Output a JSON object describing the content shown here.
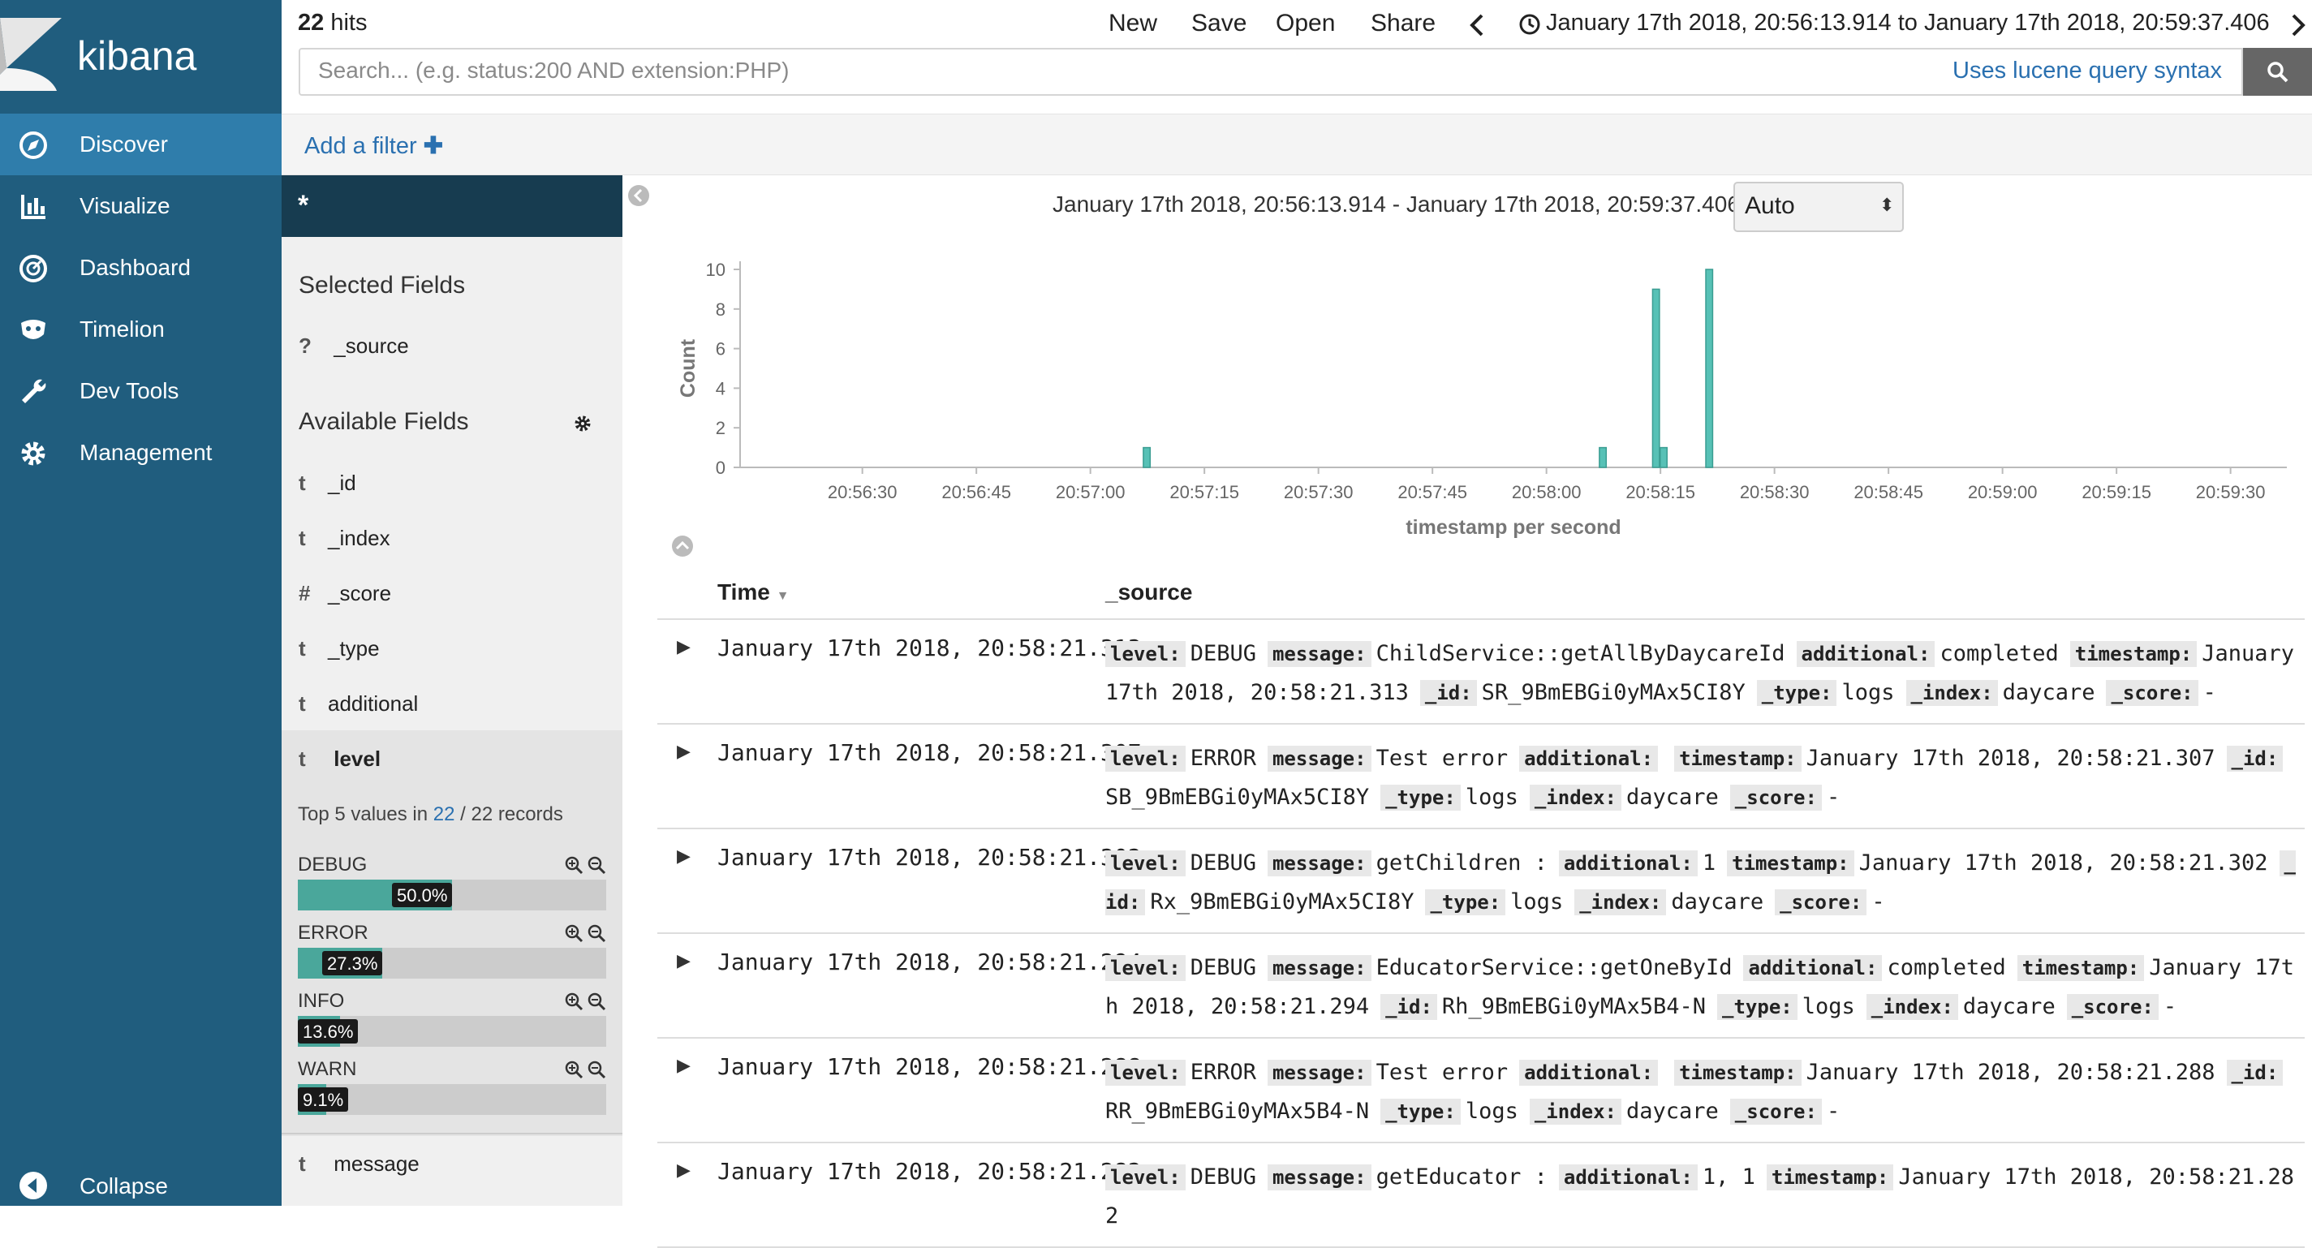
{
  "app": {
    "brand": "kibana",
    "colors": {
      "sidebar": "#205d7e",
      "active_nav": "#2f7dab",
      "accent": "#4aa79b",
      "link": "#2a70b0"
    }
  },
  "sidebar": {
    "items": [
      {
        "label": "Discover",
        "icon": "compass-icon",
        "active": true
      },
      {
        "label": "Visualize",
        "icon": "bar-chart-icon",
        "active": false
      },
      {
        "label": "Dashboard",
        "icon": "dashboard-gauge-icon",
        "active": false
      },
      {
        "label": "Timelion",
        "icon": "timelion-mask-icon",
        "active": false
      },
      {
        "label": "Dev Tools",
        "icon": "wrench-icon",
        "active": false
      },
      {
        "label": "Management",
        "icon": "gear-icon",
        "active": false
      }
    ],
    "collapse_label": "Collapse"
  },
  "topbar": {
    "hits_count": "22",
    "hits_label": "hits",
    "menu": [
      "New",
      "Save",
      "Open",
      "Share"
    ],
    "time_range": "January 17th 2018, 20:56:13.914 to January 17th 2018, 20:59:37.406"
  },
  "search": {
    "placeholder": "Search... (e.g. status:200 AND extension:PHP)",
    "syntax_link": "Uses lucene query syntax"
  },
  "filter": {
    "add_label": "Add a filter"
  },
  "fields": {
    "index_pattern": "*",
    "selected_title": "Selected Fields",
    "selected": [
      {
        "type": "?",
        "name": "_source"
      }
    ],
    "available_title": "Available Fields",
    "available": [
      {
        "type": "t",
        "name": "_id"
      },
      {
        "type": "t",
        "name": "_index"
      },
      {
        "type": "#",
        "name": "_score"
      },
      {
        "type": "t",
        "name": "_type"
      },
      {
        "type": "t",
        "name": "additional"
      },
      {
        "type": "t",
        "name": "level"
      }
    ],
    "level_details": {
      "prefix": "Top 5 values in",
      "count": "22",
      "suffix": "/ 22 records",
      "values": [
        {
          "label": "DEBUG",
          "pct_text": "50.0%",
          "pct": 50.0
        },
        {
          "label": "ERROR",
          "pct_text": "27.3%",
          "pct": 27.3
        },
        {
          "label": "INFO",
          "pct_text": "13.6%",
          "pct": 13.6
        },
        {
          "label": "WARN",
          "pct_text": "9.1%",
          "pct": 9.1
        }
      ]
    },
    "after": [
      {
        "type": "t",
        "name": "message"
      }
    ]
  },
  "histogram": {
    "subtitle": "January 17th 2018, 20:56:13.914 - January 17th 2018, 20:59:37.406 —",
    "interval": "Auto"
  },
  "chart_data": {
    "type": "bar",
    "xlabel": "timestamp per second",
    "ylabel": "Count",
    "ylim": [
      0,
      10
    ],
    "y_ticks": [
      "0",
      "2",
      "4",
      "6",
      "8",
      "10"
    ],
    "x_ticks": [
      "20:56:30",
      "20:56:45",
      "20:57:00",
      "20:57:15",
      "20:57:30",
      "20:57:45",
      "20:58:00",
      "20:58:15",
      "20:58:30",
      "20:58:45",
      "20:59:00",
      "20:59:15",
      "20:59:30"
    ],
    "x_tick_seconds": [
      16.086,
      31.086,
      46.086,
      61.086,
      76.086,
      91.086,
      106.086,
      121.086,
      136.086,
      151.086,
      166.086,
      181.086,
      196.086
    ],
    "x_range_seconds": [
      0,
      203.492
    ],
    "bars": [
      {
        "time": "20:57:07",
        "value": 1
      },
      {
        "time": "20:58:07",
        "value": 1
      },
      {
        "time": "20:58:14",
        "value": 9
      },
      {
        "time": "20:58:15",
        "value": 1
      },
      {
        "time": "20:58:21",
        "value": 10
      }
    ],
    "bar_seconds": [
      53.5,
      113.5,
      120.5,
      121.5,
      127.5
    ],
    "color": "#57c1b6"
  },
  "table": {
    "time_header": "Time",
    "source_header": "_source",
    "rows": [
      {
        "time": "January 17th 2018, 20:58:21.313",
        "fields": [
          [
            "level:",
            "DEBUG"
          ],
          [
            "message:",
            "ChildService::getAllByDaycareId"
          ],
          [
            "additional:",
            "completed"
          ],
          [
            "timestamp:",
            "January 17th 2018, 20:58:21.313"
          ],
          [
            "_id:",
            "SR_9BmEBGi0yMAx5CI8Y"
          ],
          [
            "_type:",
            "logs"
          ],
          [
            "_index:",
            "daycare"
          ],
          [
            "_score:",
            "-"
          ]
        ]
      },
      {
        "time": "January 17th 2018, 20:58:21.307",
        "fields": [
          [
            "level:",
            "ERROR"
          ],
          [
            "message:",
            "Test error"
          ],
          [
            "additional:",
            ""
          ],
          [
            "timestamp:",
            "January 17th 2018, 20:58:21.307"
          ],
          [
            "_id:",
            "SB_9BmEBGi0yMAx5CI8Y"
          ],
          [
            "_type:",
            "logs"
          ],
          [
            "_index:",
            "daycare"
          ],
          [
            "_score:",
            "-"
          ]
        ]
      },
      {
        "time": "January 17th 2018, 20:58:21.302",
        "fields": [
          [
            "level:",
            "DEBUG"
          ],
          [
            "message:",
            "getChildren :"
          ],
          [
            "additional:",
            "1"
          ],
          [
            "timestamp:",
            "January 17th 2018, 20:58:21.302"
          ],
          [
            "_id:",
            "Rx_9BmEBGi0yMAx5CI8Y"
          ],
          [
            "_type:",
            "logs"
          ],
          [
            "_index:",
            "daycare"
          ],
          [
            "_score:",
            "-"
          ]
        ]
      },
      {
        "time": "January 17th 2018, 20:58:21.294",
        "fields": [
          [
            "level:",
            "DEBUG"
          ],
          [
            "message:",
            "EducatorService::getOneById"
          ],
          [
            "additional:",
            "completed"
          ],
          [
            "timestamp:",
            "January 17th 2018, 20:58:21.294"
          ],
          [
            "_id:",
            "Rh_9BmEBGi0yMAx5B4-N"
          ],
          [
            "_type:",
            "logs"
          ],
          [
            "_index:",
            "daycare"
          ],
          [
            "_score:",
            "-"
          ]
        ]
      },
      {
        "time": "January 17th 2018, 20:58:21.288",
        "fields": [
          [
            "level:",
            "ERROR"
          ],
          [
            "message:",
            "Test error"
          ],
          [
            "additional:",
            ""
          ],
          [
            "timestamp:",
            "January 17th 2018, 20:58:21.288"
          ],
          [
            "_id:",
            "RR_9BmEBGi0yMAx5B4-N"
          ],
          [
            "_type:",
            "logs"
          ],
          [
            "_index:",
            "daycare"
          ],
          [
            "_score:",
            "-"
          ]
        ]
      },
      {
        "time": "January 17th 2018, 20:58:21.282",
        "fields": [
          [
            "level:",
            "DEBUG"
          ],
          [
            "message:",
            "getEducator :"
          ],
          [
            "additional:",
            "1, 1"
          ],
          [
            "timestamp:",
            "January 17th 2018, 20:58:21.282"
          ]
        ]
      }
    ]
  }
}
